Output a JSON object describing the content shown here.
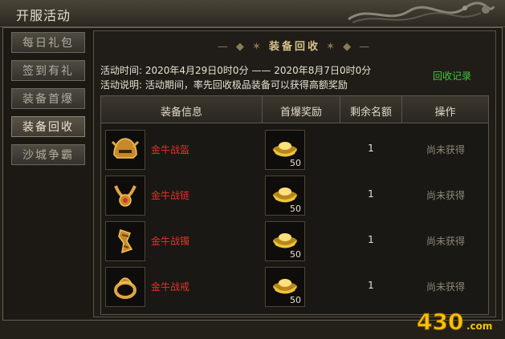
{
  "window": {
    "title": "开服活动"
  },
  "sidebar": {
    "items": [
      {
        "label": "每日礼包",
        "active": false
      },
      {
        "label": "签到有礼",
        "active": false
      },
      {
        "label": "装备首爆",
        "active": false
      },
      {
        "label": "装备回收",
        "active": true
      },
      {
        "label": "沙城争霸",
        "active": false
      }
    ]
  },
  "panel": {
    "heading": "装备回收",
    "time_line": "活动时间: 2020年4月29日0时0分 —— 2020年8月7日0时0分",
    "desc_line": "活动说明: 活动期间，率先回收极品装备可以获得高额奖励",
    "record_link": "回收记录"
  },
  "table": {
    "headers": [
      "装备信息",
      "首爆奖励",
      "剩余名额",
      "操作"
    ],
    "rows": [
      {
        "name": "金牛战盔",
        "icon": "helmet-icon",
        "reward_qty": "50",
        "remaining": "1",
        "status": "尚未获得"
      },
      {
        "name": "金牛战链",
        "icon": "necklace-icon",
        "reward_qty": "50",
        "remaining": "1",
        "status": "尚未获得"
      },
      {
        "name": "金牛战镯",
        "icon": "bracelet-icon",
        "reward_qty": "50",
        "remaining": "1",
        "status": "尚未获得"
      },
      {
        "name": "金牛战戒",
        "icon": "ring-icon",
        "reward_qty": "50",
        "remaining": "1",
        "status": "尚未获得"
      }
    ]
  },
  "watermark": {
    "brand": "430",
    "suffix": ".com"
  },
  "colors": {
    "item_name": "#e0332b",
    "record_link": "#3fcc3c",
    "status": "#8e877a",
    "gold": "#f0c43a"
  }
}
